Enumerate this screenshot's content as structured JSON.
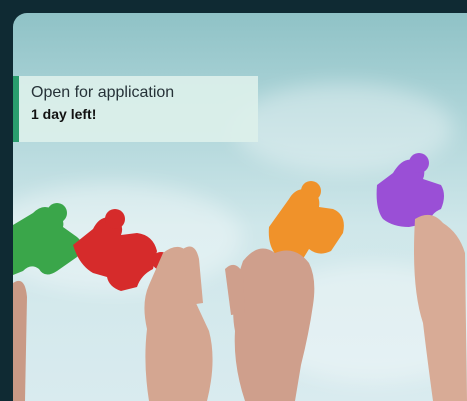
{
  "status": {
    "label": "Open for application",
    "deadline": "1 day left!"
  },
  "colors": {
    "frame": "#0f2a33",
    "accent": "#2a9d6e",
    "puzzle_green": "#3aa64a",
    "puzzle_red": "#d62b2b",
    "puzzle_orange": "#f0922a",
    "puzzle_purple": "#9a4fd6"
  }
}
